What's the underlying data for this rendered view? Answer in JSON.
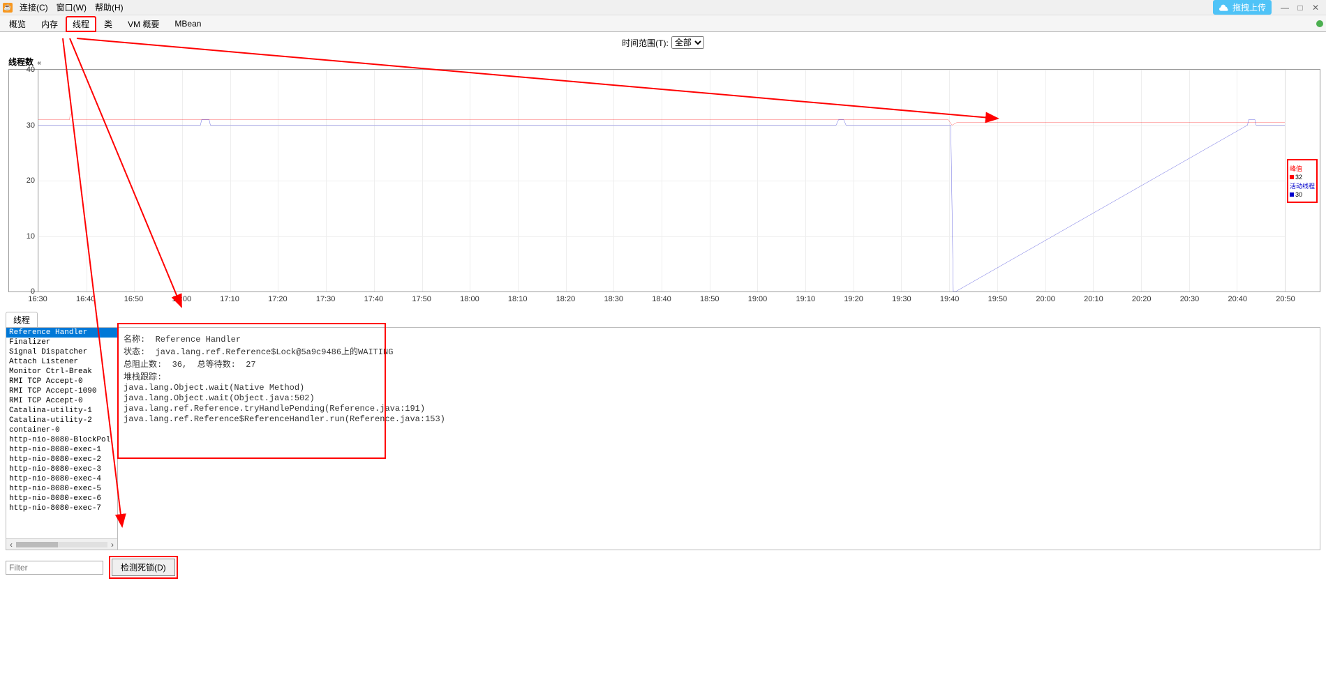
{
  "titlebar": {
    "menus": [
      "连接(C)",
      "窗口(W)",
      "帮助(H)"
    ],
    "cloud_button": "拖拽上传"
  },
  "tabs": {
    "items": [
      "概览",
      "内存",
      "线程",
      "类",
      "VM 概要",
      "MBean"
    ],
    "active_index": 2
  },
  "time_range": {
    "label": "时间范围(T):",
    "value": "全部"
  },
  "chart": {
    "title": "线程数",
    "legend": [
      {
        "name": "峰值",
        "value": "32",
        "color": "#ff0000"
      },
      {
        "name": "活动线程",
        "value": "30",
        "color": "#0000cc"
      }
    ]
  },
  "chart_data": {
    "type": "line",
    "xlabel": "",
    "ylabel": "线程数",
    "ylim": [
      0,
      40
    ],
    "x_ticks": [
      "16:30",
      "16:40",
      "16:50",
      "17:00",
      "17:10",
      "17:20",
      "17:30",
      "17:40",
      "17:50",
      "18:00",
      "18:10",
      "18:20",
      "18:30",
      "18:40",
      "18:50",
      "19:00",
      "19:10",
      "19:20",
      "19:30",
      "19:40",
      "19:50",
      "20:00",
      "20:10",
      "20:20",
      "20:30",
      "20:40",
      "20:50"
    ],
    "y_ticks": [
      0,
      10,
      20,
      30,
      40
    ],
    "series": [
      {
        "name": "峰值",
        "color": "#ff0000",
        "points": [
          [
            0,
            31
          ],
          [
            2.5,
            31
          ],
          [
            2.55,
            32
          ],
          [
            2.7,
            32
          ],
          [
            2.75,
            31
          ],
          [
            73,
            31
          ],
          [
            73.3,
            30
          ],
          [
            73.7,
            30.5
          ],
          [
            100,
            30.5
          ]
        ]
      },
      {
        "name": "活动线程",
        "color": "#0000cc",
        "points": [
          [
            0,
            30
          ],
          [
            13,
            30
          ],
          [
            13.1,
            31
          ],
          [
            13.7,
            31
          ],
          [
            13.8,
            30
          ],
          [
            64,
            30
          ],
          [
            64.2,
            31
          ],
          [
            64.6,
            31
          ],
          [
            64.8,
            30
          ],
          [
            73.2,
            30
          ],
          [
            73.4,
            0
          ],
          [
            73.6,
            0
          ],
          [
            97,
            30
          ],
          [
            97.1,
            31
          ],
          [
            97.6,
            31
          ],
          [
            97.7,
            30
          ],
          [
            100,
            30
          ]
        ]
      }
    ]
  },
  "threads_tab_label": "线程",
  "thread_list": [
    "Reference Handler",
    "Finalizer",
    "Signal Dispatcher",
    "Attach Listener",
    "Monitor Ctrl-Break",
    "RMI TCP Accept-0",
    "RMI TCP Accept-1090",
    "RMI TCP Accept-0",
    "Catalina-utility-1",
    "Catalina-utility-2",
    "container-0",
    "http-nio-8080-BlockPol",
    "http-nio-8080-exec-1",
    "http-nio-8080-exec-2",
    "http-nio-8080-exec-3",
    "http-nio-8080-exec-4",
    "http-nio-8080-exec-5",
    "http-nio-8080-exec-6",
    "http-nio-8080-exec-7"
  ],
  "thread_detail": {
    "name_label": "名称:",
    "name_value": "Reference Handler",
    "state_label": "状态:",
    "state_value": "java.lang.ref.Reference$Lock@5a9c9486上的WAITING",
    "blocked_label": "总阻止数:",
    "blocked_value": "36,",
    "waited_label": "总等待数:",
    "waited_value": "27",
    "stack_label": "堆栈跟踪:",
    "stack_lines": [
      "java.lang.Object.wait(Native Method)",
      "java.lang.Object.wait(Object.java:502)",
      "java.lang.ref.Reference.tryHandlePending(Reference.java:191)",
      "java.lang.ref.Reference$ReferenceHandler.run(Reference.java:153)"
    ]
  },
  "filter_placeholder": "Filter",
  "deadlock_button": "检测死锁(D)"
}
